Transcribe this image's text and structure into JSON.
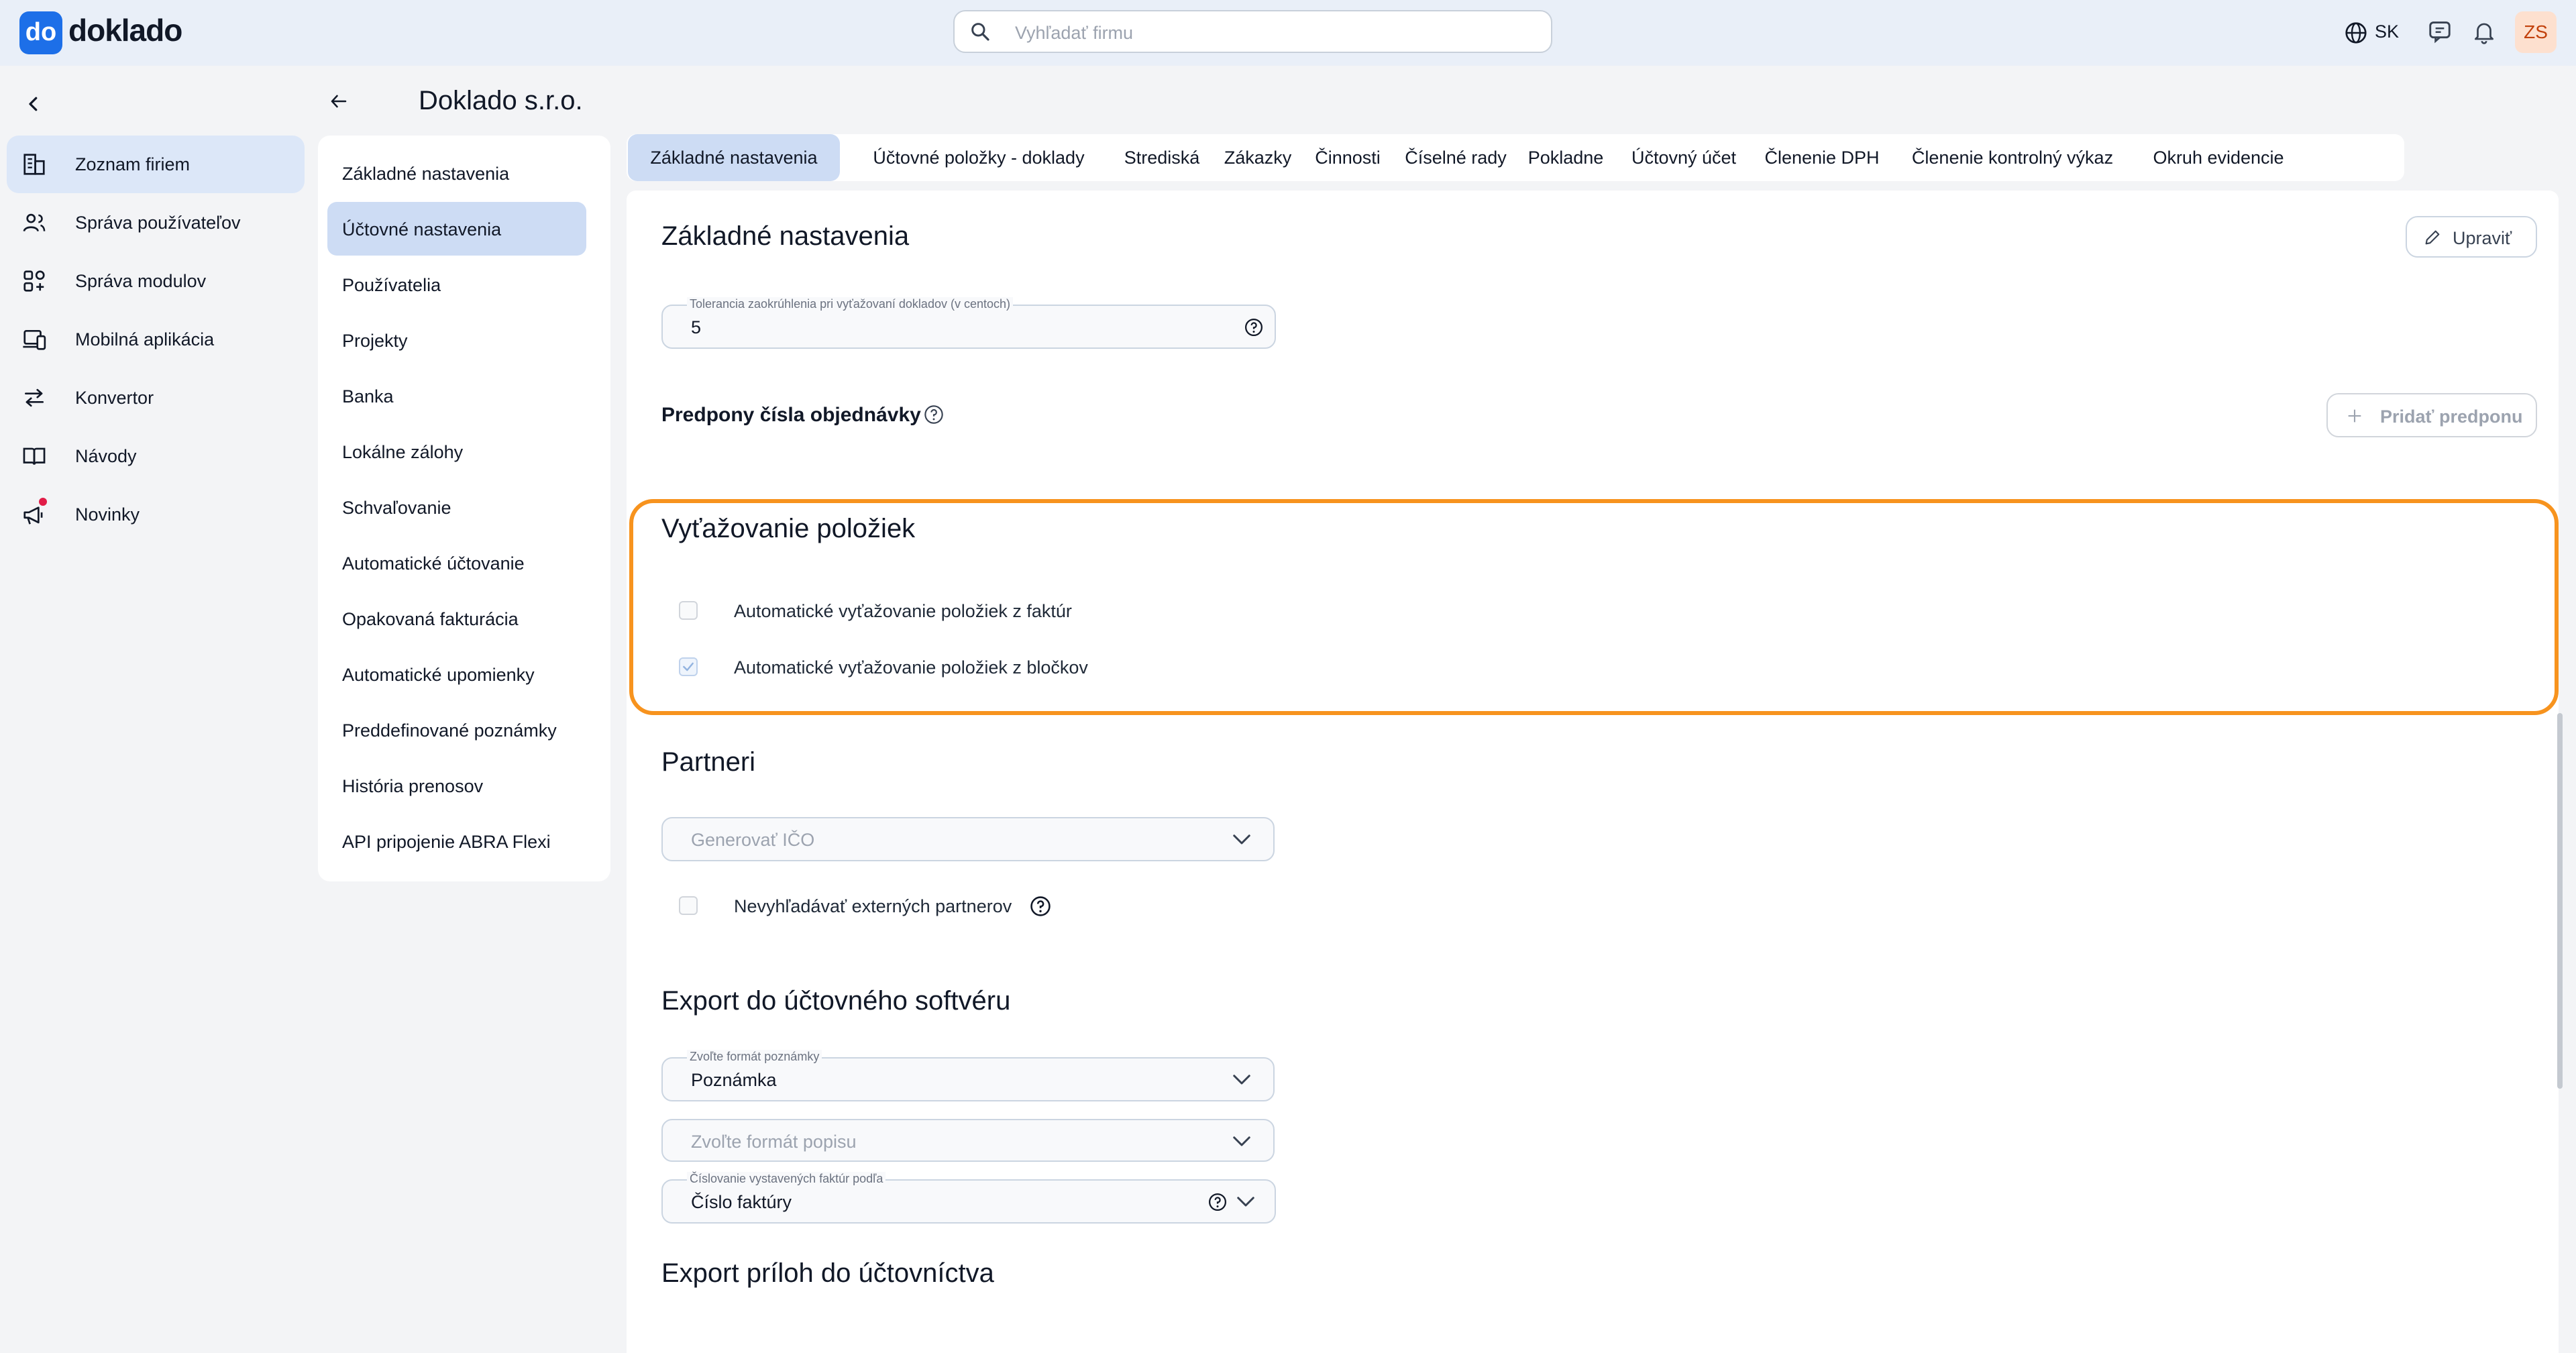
{
  "app": {
    "logo_mark": "do",
    "logo_text": "doklado"
  },
  "topbar": {
    "search_placeholder": "Vyhľadať firmu",
    "language": "SK",
    "avatar_initials": "ZS"
  },
  "sidebar": {
    "items": [
      {
        "label": "Zoznam firiem",
        "icon": "company-list-icon",
        "active": true
      },
      {
        "label": "Správa používateľov",
        "icon": "users-icon"
      },
      {
        "label": "Správa modulov",
        "icon": "modules-icon"
      },
      {
        "label": "Mobilná aplikácia",
        "icon": "mobile-app-icon"
      },
      {
        "label": "Konvertor",
        "icon": "convert-arrows-icon"
      },
      {
        "label": "Návody",
        "icon": "book-icon"
      },
      {
        "label": "Novinky",
        "icon": "megaphone-icon"
      }
    ]
  },
  "page": {
    "title": "Doklado s.r.o."
  },
  "subnav": {
    "items": [
      "Základné nastavenia",
      "Účtovné nastavenia",
      "Používatelia",
      "Projekty",
      "Banka",
      "Lokálne zálohy",
      "Schvaľovanie",
      "Automatické účtovanie",
      "Opakovaná fakturácia",
      "Automatické upomienky",
      "Preddefinované poznámky",
      "História prenosov",
      "API pripojenie ABRA Flexi"
    ],
    "active_index": 1
  },
  "tabs": [
    "Základné nastavenia",
    "Účtovné položky - doklady",
    "Strediská",
    "Zákazky",
    "Činnosti",
    "Číselné rady",
    "Pokladne",
    "Účtovný účet",
    "Členenie DPH",
    "Členenie kontrolný výkaz",
    "Okruh evidencie"
  ],
  "content": {
    "section_title": "Základné nastavenia",
    "edit_button": "Upraviť",
    "tolerance": {
      "caption": "Tolerancia zaokrúhlenia pri vyťažovaní dokladov (v centoch)",
      "value": "5"
    },
    "order_prefixes": {
      "title": "Predpony čísla objednávky",
      "add_button": "Pridať predponu"
    },
    "extraction": {
      "title": "Vyťažovanie položiek",
      "options": [
        {
          "label": "Automatické vyťažovanie položiek z faktúr",
          "checked": false
        },
        {
          "label": "Automatické vyťažovanie položiek z bločkov",
          "checked": true
        }
      ]
    },
    "partners": {
      "title": "Partneri",
      "ico_placeholder": "Generovať IČO",
      "no_search_label": "Nevyhľadávať externých partnerov"
    },
    "export": {
      "title": "Export do účtovného softvéru",
      "note_caption": "Zvoľte formát poznámky",
      "note_value": "Poznámka",
      "desc_placeholder": "Zvoľte formát popisu",
      "numbering_caption": "Číslovanie vystavených faktúr podľa",
      "numbering_value": "Číslo faktúry"
    },
    "attachments": {
      "title": "Export príloh do účtovníctva"
    }
  },
  "colors": {
    "accent": "#1d6fe8",
    "highlight": "#f7931e",
    "active_bg": "#cddcf4"
  }
}
